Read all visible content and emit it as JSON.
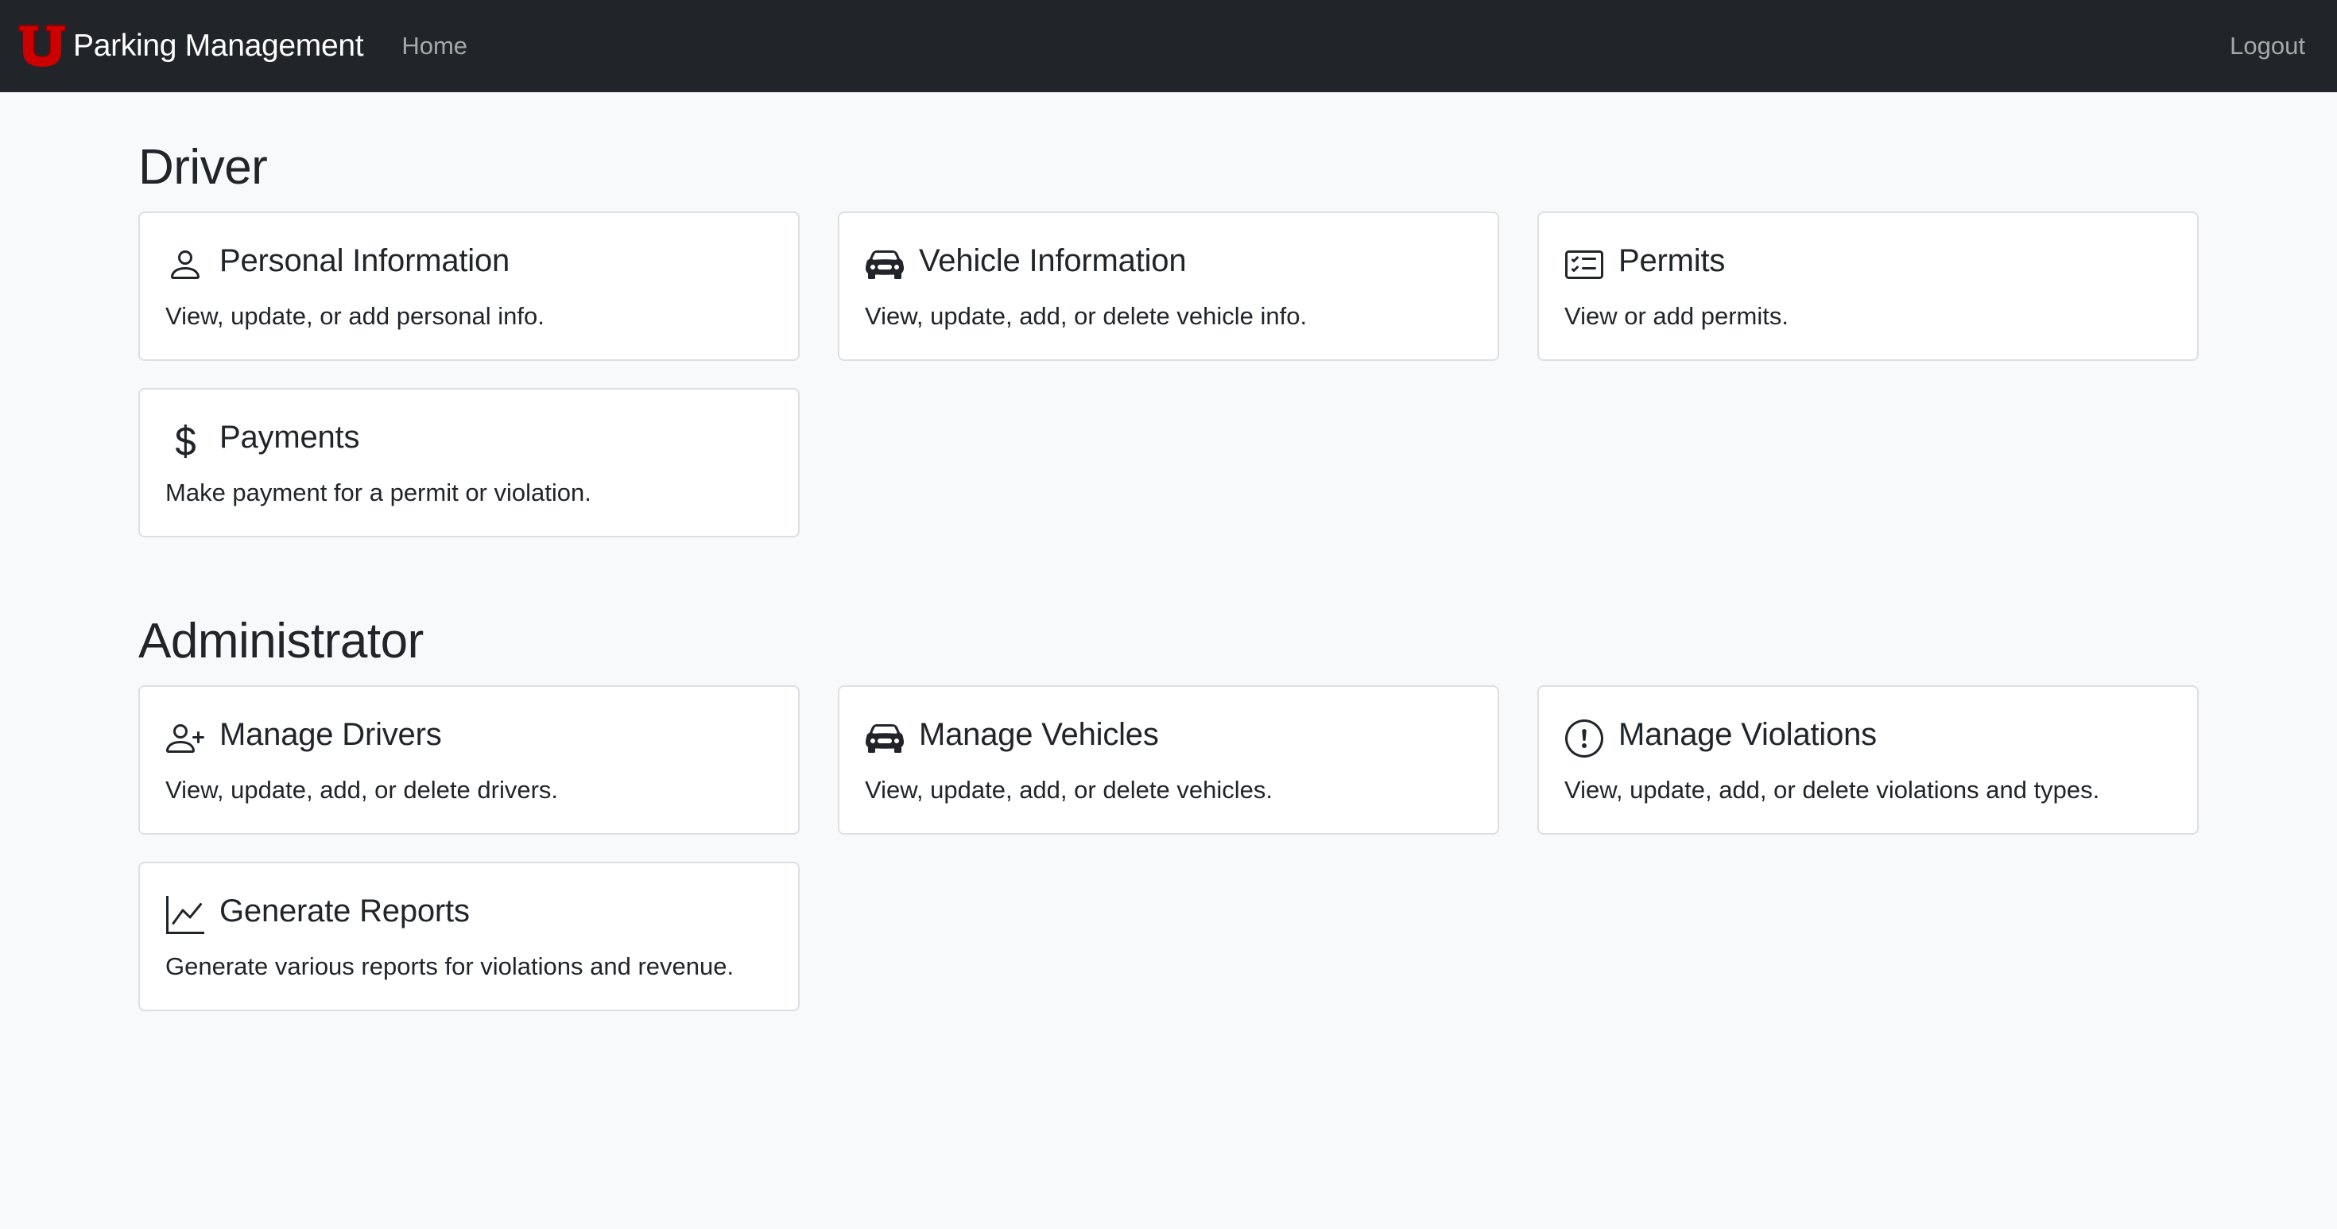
{
  "navbar": {
    "brand": "Parking Management",
    "home": "Home",
    "logout": "Logout"
  },
  "driver": {
    "title": "Driver",
    "cards": [
      {
        "title": "Personal Information",
        "text": "View, update, or add personal info.",
        "icon": "person-icon"
      },
      {
        "title": "Vehicle Information",
        "text": "View, update, add, or delete vehicle info.",
        "icon": "car-icon"
      },
      {
        "title": "Permits",
        "text": "View or add permits.",
        "icon": "card-checklist-icon"
      },
      {
        "title": "Payments",
        "text": "Make payment for a permit or violation.",
        "icon": "dollar-icon"
      }
    ]
  },
  "admin": {
    "title": "Administrator",
    "cards": [
      {
        "title": "Manage Drivers",
        "text": "View, update, add, or delete drivers.",
        "icon": "person-plus-icon"
      },
      {
        "title": "Manage Vehicles",
        "text": "View, update, add, or delete vehicles.",
        "icon": "car-icon"
      },
      {
        "title": "Manage Violations",
        "text": "View, update, add, or delete violations and types.",
        "icon": "exclamation-circle-icon"
      },
      {
        "title": "Generate Reports",
        "text": "Generate various reports for violations and revenue.",
        "icon": "graph-up-icon"
      }
    ]
  },
  "colors": {
    "navbar_bg": "#212529",
    "logo_red": "#cc0000",
    "page_bg": "#f8f9fa",
    "card_border": "#dcdfe3"
  }
}
